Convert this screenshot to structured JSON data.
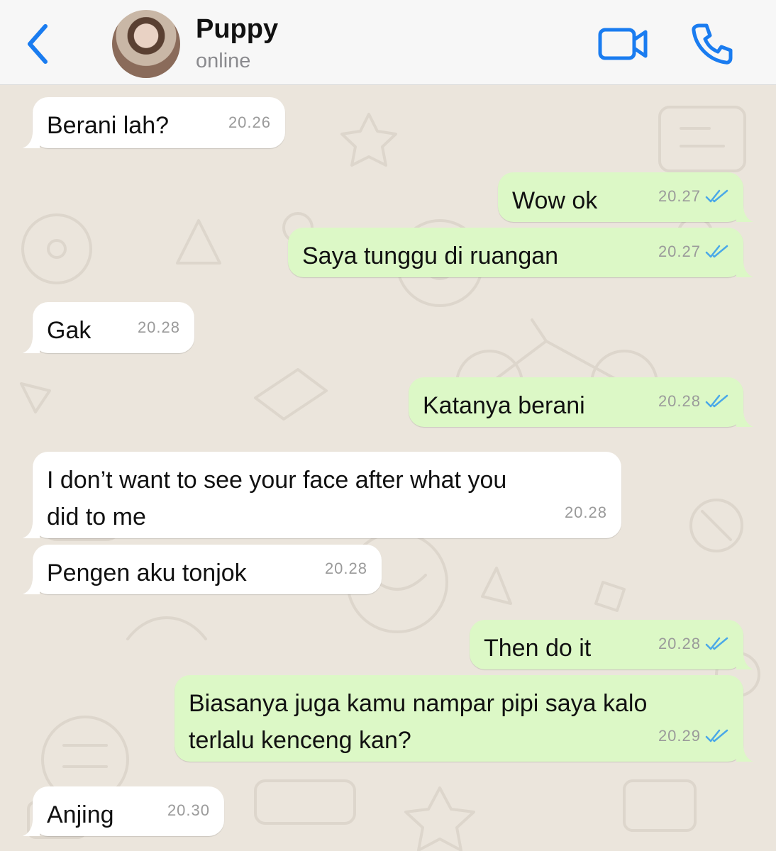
{
  "header": {
    "back_icon": "chevron-left-icon",
    "contact_name": "Puppy",
    "status": "online",
    "video_icon": "video-camera-icon",
    "call_icon": "phone-icon",
    "accent": "#1a7cf0"
  },
  "colors": {
    "incoming_bubble": "#ffffff",
    "outgoing_bubble": "#dcf8c6",
    "chat_background": "#ebe5dc",
    "read_ticks": "#4aa8e8"
  },
  "messages": [
    {
      "dir": "in",
      "text": "Berani lah?",
      "time": "20.26"
    },
    {
      "dir": "out",
      "text": "Wow ok",
      "time": "20.27",
      "status": "read"
    },
    {
      "dir": "out",
      "text": "Saya tunggu di ruangan",
      "time": "20.27",
      "status": "read"
    },
    {
      "dir": "in",
      "text": "Gak",
      "time": "20.28"
    },
    {
      "dir": "out",
      "text": "Katanya berani",
      "time": "20.28",
      "status": "read"
    },
    {
      "dir": "in",
      "text": "I don’t want to see your face after what you did to me",
      "time": "20.28"
    },
    {
      "dir": "in",
      "text": "Pengen aku tonjok",
      "time": "20.28"
    },
    {
      "dir": "out",
      "text": "Then do it",
      "time": "20.28",
      "status": "read"
    },
    {
      "dir": "out",
      "text": "Biasanya juga kamu nampar pipi saya kalo terlalu kenceng kan?",
      "time": "20.29",
      "status": "read"
    },
    {
      "dir": "in",
      "text": "Anjing",
      "time": "20.30"
    }
  ]
}
